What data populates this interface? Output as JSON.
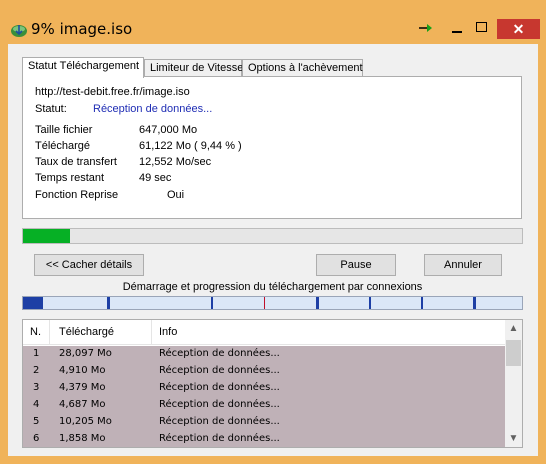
{
  "window": {
    "title": "9% image.iso",
    "close_label": "✕"
  },
  "tabs": [
    {
      "label": "Statut Téléchargement"
    },
    {
      "label": "Limiteur de Vitesse"
    },
    {
      "label": "Options à l'achèvement"
    }
  ],
  "status": {
    "url": "http://test-debit.free.fr/image.iso",
    "status_label": "Statut:",
    "status_value": "Réception de données...",
    "rows": [
      {
        "label": "Taille fichier",
        "value": "647,000  Mo"
      },
      {
        "label": "Téléchargé",
        "value": "61,122  Mo  ( 9,44 % )"
      },
      {
        "label": "Taux de transfert",
        "value": "12,552  Mo/sec"
      },
      {
        "label": "Temps restant",
        "value": "49 sec"
      },
      {
        "label": "Fonction Reprise",
        "value": "Oui"
      }
    ]
  },
  "progress": {
    "percent": 9.44
  },
  "buttons": {
    "hide_details": "<< Cacher détails",
    "pause": "Pause",
    "cancel": "Annuler"
  },
  "connections": {
    "caption": "Démarrage et progression du téléchargement par connexions"
  },
  "table": {
    "headers": [
      "N.",
      "Téléchargé",
      "Info"
    ],
    "rows": [
      {
        "n": "1",
        "downloaded": "28,097 Mo",
        "info": "Réception de données..."
      },
      {
        "n": "2",
        "downloaded": "4,910 Mo",
        "info": "Réception de données..."
      },
      {
        "n": "3",
        "downloaded": "4,379 Mo",
        "info": "Réception de données..."
      },
      {
        "n": "4",
        "downloaded": "4,687 Mo",
        "info": "Réception de données..."
      },
      {
        "n": "5",
        "downloaded": "10,205 Mo",
        "info": "Réception de données..."
      },
      {
        "n": "6",
        "downloaded": "1,858 Mo",
        "info": "Réception de données..."
      }
    ]
  },
  "colors": {
    "frame": "#f0b35a",
    "progress_fill": "#06b025",
    "row_bg": "#bfb1b7",
    "status_blue": "#1f2db4"
  }
}
